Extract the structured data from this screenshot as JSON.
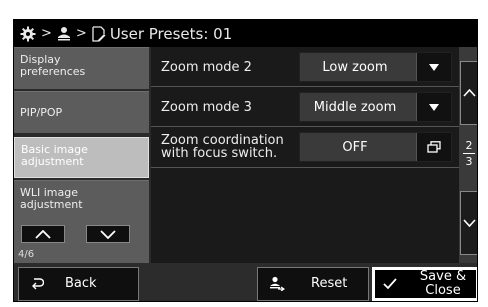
{
  "header": {
    "title": "User Presets: 01",
    "icons": [
      "gear-icon",
      "user-icon",
      "edit-icon"
    ]
  },
  "sidebar": {
    "items": [
      {
        "label_line1": "Display",
        "label_line2": "preferences",
        "active": false
      },
      {
        "label_line1": "PIP/POP",
        "label_line2": "",
        "active": false
      },
      {
        "label_line1": "Basic image",
        "label_line2": "adjustment",
        "active": true
      },
      {
        "label_line1": "WLI image",
        "label_line2": "adjustment",
        "active": false
      }
    ],
    "page_indicator": "4/6"
  },
  "settings": [
    {
      "label_line1": "Zoom mode 2",
      "label_line2": "",
      "value": "Low zoom",
      "control": "dropdown"
    },
    {
      "label_line1": "Zoom mode 3",
      "label_line2": "",
      "value": "Middle zoom",
      "control": "dropdown"
    },
    {
      "label_line1": "Zoom coordination",
      "label_line2": "with focus switch.",
      "value": "OFF",
      "control": "popup"
    }
  ],
  "scroll": {
    "current": "2",
    "total": "3"
  },
  "footer": {
    "back_label": "Back",
    "reset_label": "Reset",
    "save_label_line1": "Save &",
    "save_label_line2": "Close"
  },
  "colors": {
    "panel_bg": "#3d3d3d",
    "row_bg": "#1a1a1a",
    "active_item": "#bdbdbd",
    "button_bg": "#0f0f0f",
    "save_button_bg": "#ffffff"
  }
}
